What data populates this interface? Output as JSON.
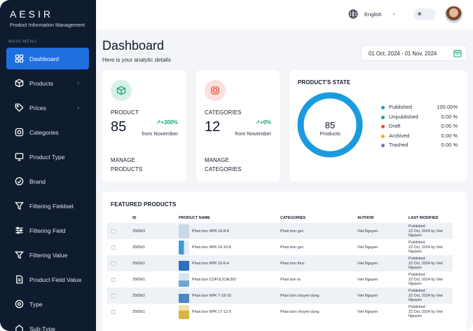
{
  "app": {
    "logo": "AESIR",
    "subtitle": "Product Information Management"
  },
  "sidebar": {
    "section_label": "MAIN MENU",
    "items": [
      {
        "label": "Dashboard",
        "icon": "dashboard-icon",
        "active": true
      },
      {
        "label": "Products",
        "icon": "box-icon",
        "has_chevron": true
      },
      {
        "label": "Prices",
        "icon": "tag-icon",
        "has_chevron": true
      },
      {
        "label": "Categories",
        "icon": "categories-icon"
      },
      {
        "label": "Product Type",
        "icon": "product-type-icon"
      },
      {
        "label": "Brand",
        "icon": "brand-icon"
      },
      {
        "label": "Filtering Fieldset",
        "icon": "filter-icon"
      },
      {
        "label": "Filtering Field",
        "icon": "sliders-icon"
      },
      {
        "label": "Filtering Value",
        "icon": "filter-lines-icon"
      },
      {
        "label": "Product Field Value",
        "icon": "document-icon"
      },
      {
        "label": "Type",
        "icon": "type-icon"
      },
      {
        "label": "Sub-Type",
        "icon": "sub-type-icon"
      }
    ]
  },
  "header": {
    "language": "English",
    "theme_icon": "sun-icon"
  },
  "main": {
    "title": "Dashboard",
    "subtitle": "Here is your analytic details",
    "date_range": "01 Oct, 2024 - 01 Nov, 2024"
  },
  "stats": {
    "product": {
      "label": "PRODUCT",
      "value": "85",
      "change": "+300%",
      "from": "from November",
      "manage": "MANAGE PRODUCTS"
    },
    "categories": {
      "label": "CATEGORIES",
      "value": "12",
      "change": "+0%",
      "from": "from November",
      "manage": "MANAGE CATEGORIES"
    }
  },
  "product_state": {
    "title": "PRODUCT'S STATE",
    "total": "85",
    "total_label": "Products",
    "legend": [
      {
        "name": "Published",
        "value": "100.00%",
        "color": "#1a9be0"
      },
      {
        "name": "Unpublished",
        "value": "0.00 %",
        "color": "#1aa77a"
      },
      {
        "name": "Draft",
        "value": "0.00 %",
        "color": "#e5533d"
      },
      {
        "name": "Archived",
        "value": "0.00 %",
        "color": "#f2a51a"
      },
      {
        "name": "Trashed",
        "value": "0.00 %",
        "color": "#6e6fd8"
      }
    ],
    "donut_color": "#1a9be0"
  },
  "featured": {
    "title": "FEATURED PRODUCTS",
    "columns": [
      "ID",
      "PRODUCT NAME",
      "CATEGORIES",
      "AUTHOR",
      "LAST MODIFIED"
    ],
    "rows": [
      {
        "id": "256563",
        "name": "Phan bon NPK 16-8-8",
        "category": "Phan bon goc",
        "author": "Viet Nguyen",
        "status": "Published",
        "modified": "22 Oct, 2024 by Viet Nguyen",
        "thumb": "#c9d6e6"
      },
      {
        "id": "256561",
        "name": "Phan bon NPK 16-16-8",
        "category": "Phan bon goc",
        "author": "Viet Nguyen",
        "status": "Published",
        "modified": "22 Oct, 2024 by Viet Nguyen",
        "thumb": "#3d9ad6"
      },
      {
        "id": "256562",
        "name": "Phan bon NPK 10-6-4",
        "category": "Phan bon thuc",
        "author": "Viet Nguyen",
        "status": "Published",
        "modified": "22 Oct, 2024 by Viet Nguyen",
        "thumb": "#2f6fc0"
      },
      {
        "id": "256561",
        "name": "Phan bon COFOLICALBO",
        "category": "Phan bon la",
        "author": "Viet Nguyen",
        "status": "Published",
        "modified": "22 Oct, 2024 by Viet Nguyen",
        "thumb": "#d8e4f0"
      },
      {
        "id": "256562",
        "name": "Phan bon NPK 7-18-15",
        "category": "Phan bon chuyen dung",
        "author": "Viet Nguyen",
        "status": "Published",
        "modified": "22 Oct, 2024 by Viet Nguyen",
        "thumb": "#4a86c8"
      },
      {
        "id": "256561",
        "name": "Phan bon NPK 17-12-5",
        "category": "Phan bon chuyen dung",
        "author": "Viet Nguyen",
        "status": "Published",
        "modified": "22 Oct, 2024 by Viet Nguyen",
        "thumb": "#d9b341"
      }
    ]
  }
}
